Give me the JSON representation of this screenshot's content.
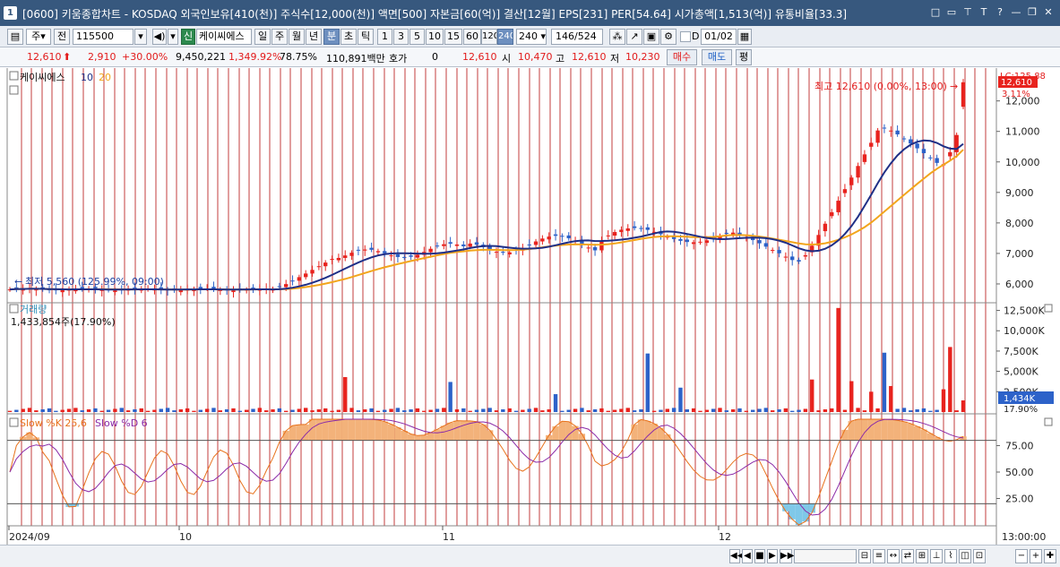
{
  "window": {
    "icon": "1",
    "title": "[0600] 키움종합차트 - KOSDAQ 외국인보유[410(천)] 주식수[12,000(천)] 액면[500] 자본금[60(억)] 결산[12월] EPS[231] PER[54.64] 시가총액[1,513(억)] 유통비율[33.3]",
    "buttons": [
      "□",
      "▭",
      "⊤",
      "T",
      "?",
      "—",
      "❐",
      "✕"
    ]
  },
  "toolbar": {
    "period_select": "주",
    "all_label": "전",
    "code": "115500",
    "new_label": "신",
    "stock_name": "케이씨에스",
    "period_tabs": [
      "일",
      "주",
      "월",
      "년",
      "분",
      "초",
      "틱"
    ],
    "selected_period": "분",
    "intervals": [
      "1",
      "3",
      "5",
      "10",
      "15",
      "60",
      "120",
      "240"
    ],
    "selected_interval": "240",
    "interval_value": "240",
    "count": "146",
    "count_total": "/524",
    "date_checkbox_label": "D",
    "date_value": "01/02"
  },
  "quote": {
    "price": "12,610",
    "change": "2,910",
    "change_pct": "+30.00%",
    "volume": "9,450,221",
    "volume_ratio": "1,349.92%",
    "turnover_pct": "78.75%",
    "amount": "110,891백만",
    "hoga_label": "호가",
    "hoga_value": "0",
    "hoga_price": "12,610",
    "open_label": "시",
    "open": "10,470",
    "high_label": "고",
    "high": "12,610",
    "low_label": "저",
    "low": "10,230",
    "buy_label": "매수",
    "sell_label": "매도",
    "avg_label": "평"
  },
  "chart": {
    "price_pane": {
      "legend_name": "케이씨에스",
      "ma_periods": [
        "10",
        "20"
      ],
      "high_annotation": "최고 12,610 (0.00%, 13:00)",
      "low_annotation": "최저 5,560 (125.99%, 09:00)",
      "current_price_label": "12,610",
      "current_pct_label": "3.11%",
      "lc_label": "LC:125.88",
      "y_ticks": [
        "12,000",
        "11,000",
        "10,000",
        "9,000",
        "8,000",
        "7,000",
        "6,000"
      ]
    },
    "volume_pane": {
      "legend_name": "거래량",
      "last_value": "1,433,854주(17.90%)",
      "current_label": "1,434K",
      "current_pct": "17.90%",
      "y_ticks": [
        "12,500K",
        "10,000K",
        "7,500K",
        "5,000K",
        "2,500K"
      ]
    },
    "stoch_pane": {
      "legend_k": "Slow %K 25,6",
      "legend_d": "Slow %D 6",
      "y_ticks": [
        "75.00",
        "50.00",
        "25.00"
      ]
    },
    "x_labels": [
      "2024/09",
      "10",
      "11",
      "12"
    ],
    "time_label": "13:00:00",
    "colors": {
      "up": "#e8231e",
      "down": "#2d62c9",
      "ma10": "#1f2f86",
      "ma20": "#f2a51c",
      "stoch_k": "#e8721c",
      "stoch_d": "#8a2aa8",
      "grid": "#c33c3c"
    }
  },
  "chart_data": {
    "type": "candlestick",
    "x_categories": [
      "2024/09",
      "10",
      "11",
      "12"
    ],
    "price_range": [
      5500,
      12900
    ],
    "volume_range_k": [
      0,
      13000
    ],
    "stoch_range": [
      0,
      100
    ],
    "series": [
      {
        "name": "케이씨에스",
        "note": "4-hour candles",
        "high": 12610,
        "low": 5560,
        "last_close": 12610
      },
      {
        "name": "10",
        "type": "moving-average"
      },
      {
        "name": "20",
        "type": "moving-average"
      },
      {
        "name": "Slow %K 25,6",
        "last": 65
      },
      {
        "name": "Slow %D 6",
        "last": 60
      }
    ],
    "last_volume_k": 1434
  },
  "bottombar": {
    "nav_buttons": [
      "◀◀",
      "◀",
      "■",
      "▶",
      "▶▶"
    ],
    "zoom_buttons": [
      "−",
      "+"
    ]
  }
}
